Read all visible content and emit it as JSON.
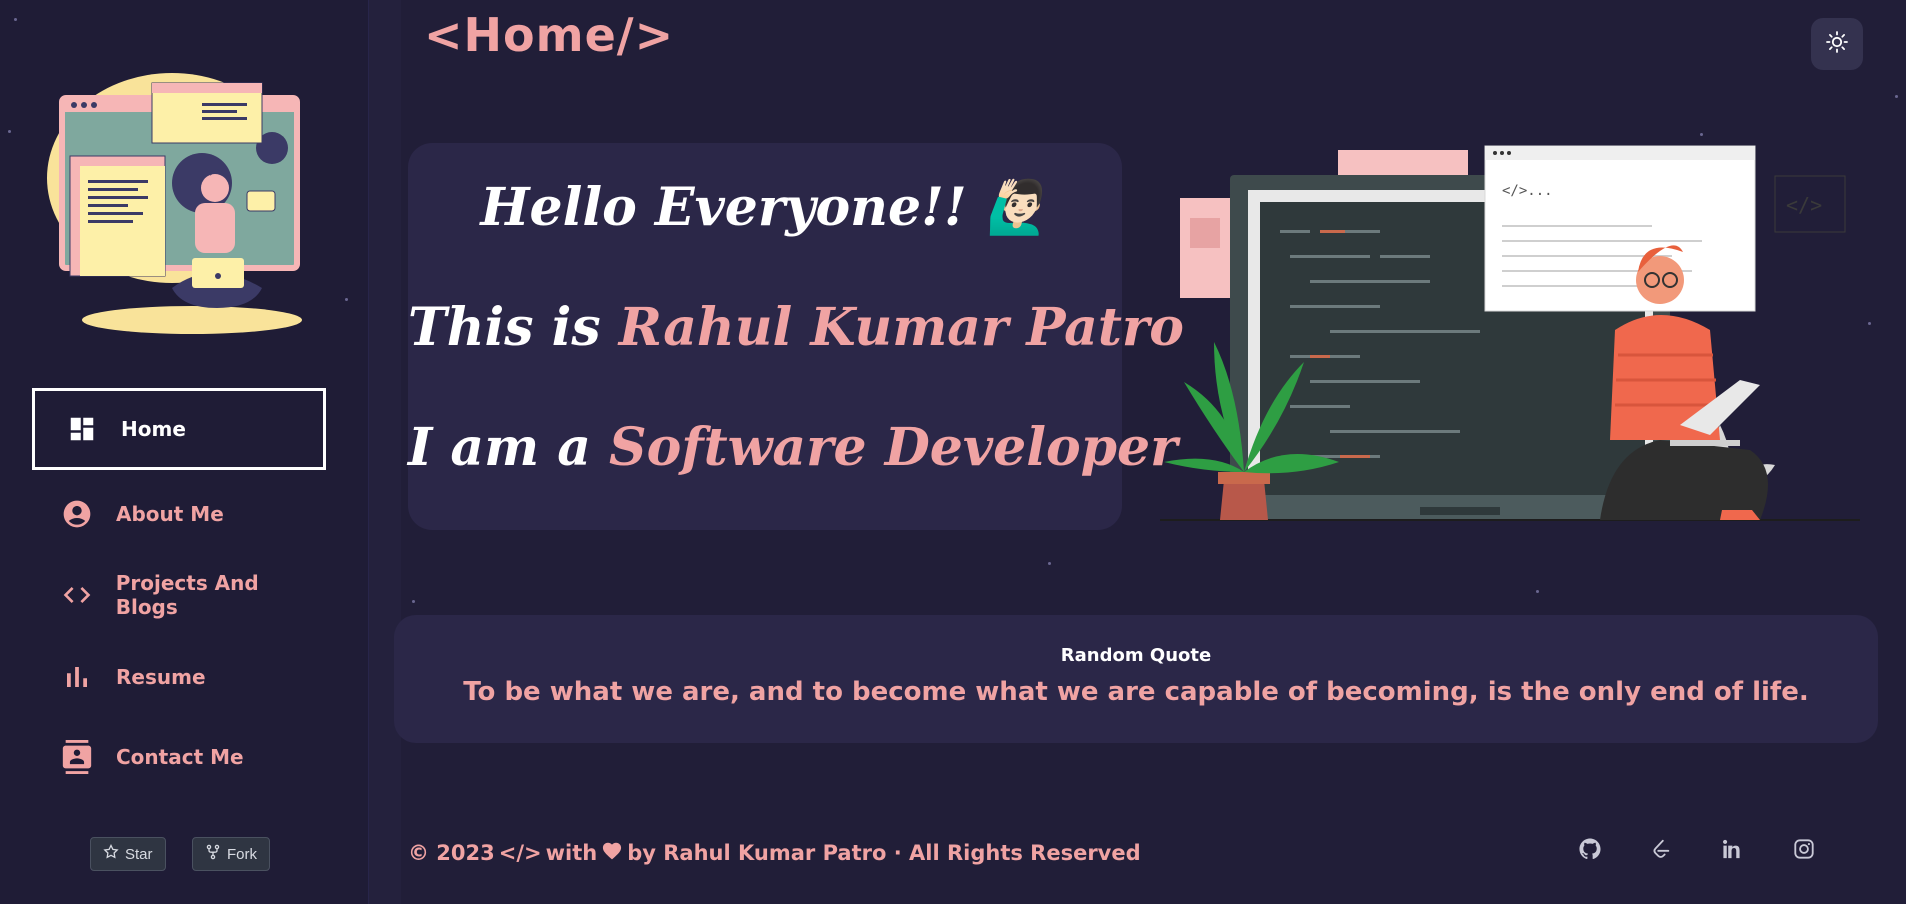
{
  "page": {
    "title": "<Home/>"
  },
  "sidebar": {
    "nav": [
      {
        "label": "Home",
        "icon": "dashboard-icon",
        "active": true
      },
      {
        "label": "About Me",
        "icon": "account-circle-icon"
      },
      {
        "label": "Projects And Blogs",
        "icon": "code-icon"
      },
      {
        "label": "Resume",
        "icon": "bar-chart-icon"
      },
      {
        "label": "Contact Me",
        "icon": "contact-card-icon"
      }
    ],
    "github": {
      "star_label": "Star",
      "fork_label": "Fork"
    }
  },
  "hero": {
    "line1": "Hello Everyone!!",
    "line1_emoji": "🙋🏻‍♂️",
    "line2_prefix": "This is ",
    "line2_name": "Rahul Kumar Patro",
    "line3_prefix": "I am a ",
    "line3_role": "Software Developer"
  },
  "quote": {
    "title": "Random Quote",
    "text": "To be what we are, and to become what we are capable of becoming, is the only end of life."
  },
  "footer": {
    "copyright": "© 2023",
    "code_symbol": "</>",
    "with": "with",
    "by": "by Rahul Kumar Patro · All Rights Reserved",
    "social": [
      "github-icon",
      "leetcode-icon",
      "linkedin-icon",
      "instagram-icon"
    ]
  },
  "colors": {
    "accent": "#f0a3a3",
    "background": "#211e38",
    "card": "#2b2748",
    "sidebar": "#1f1c36"
  }
}
